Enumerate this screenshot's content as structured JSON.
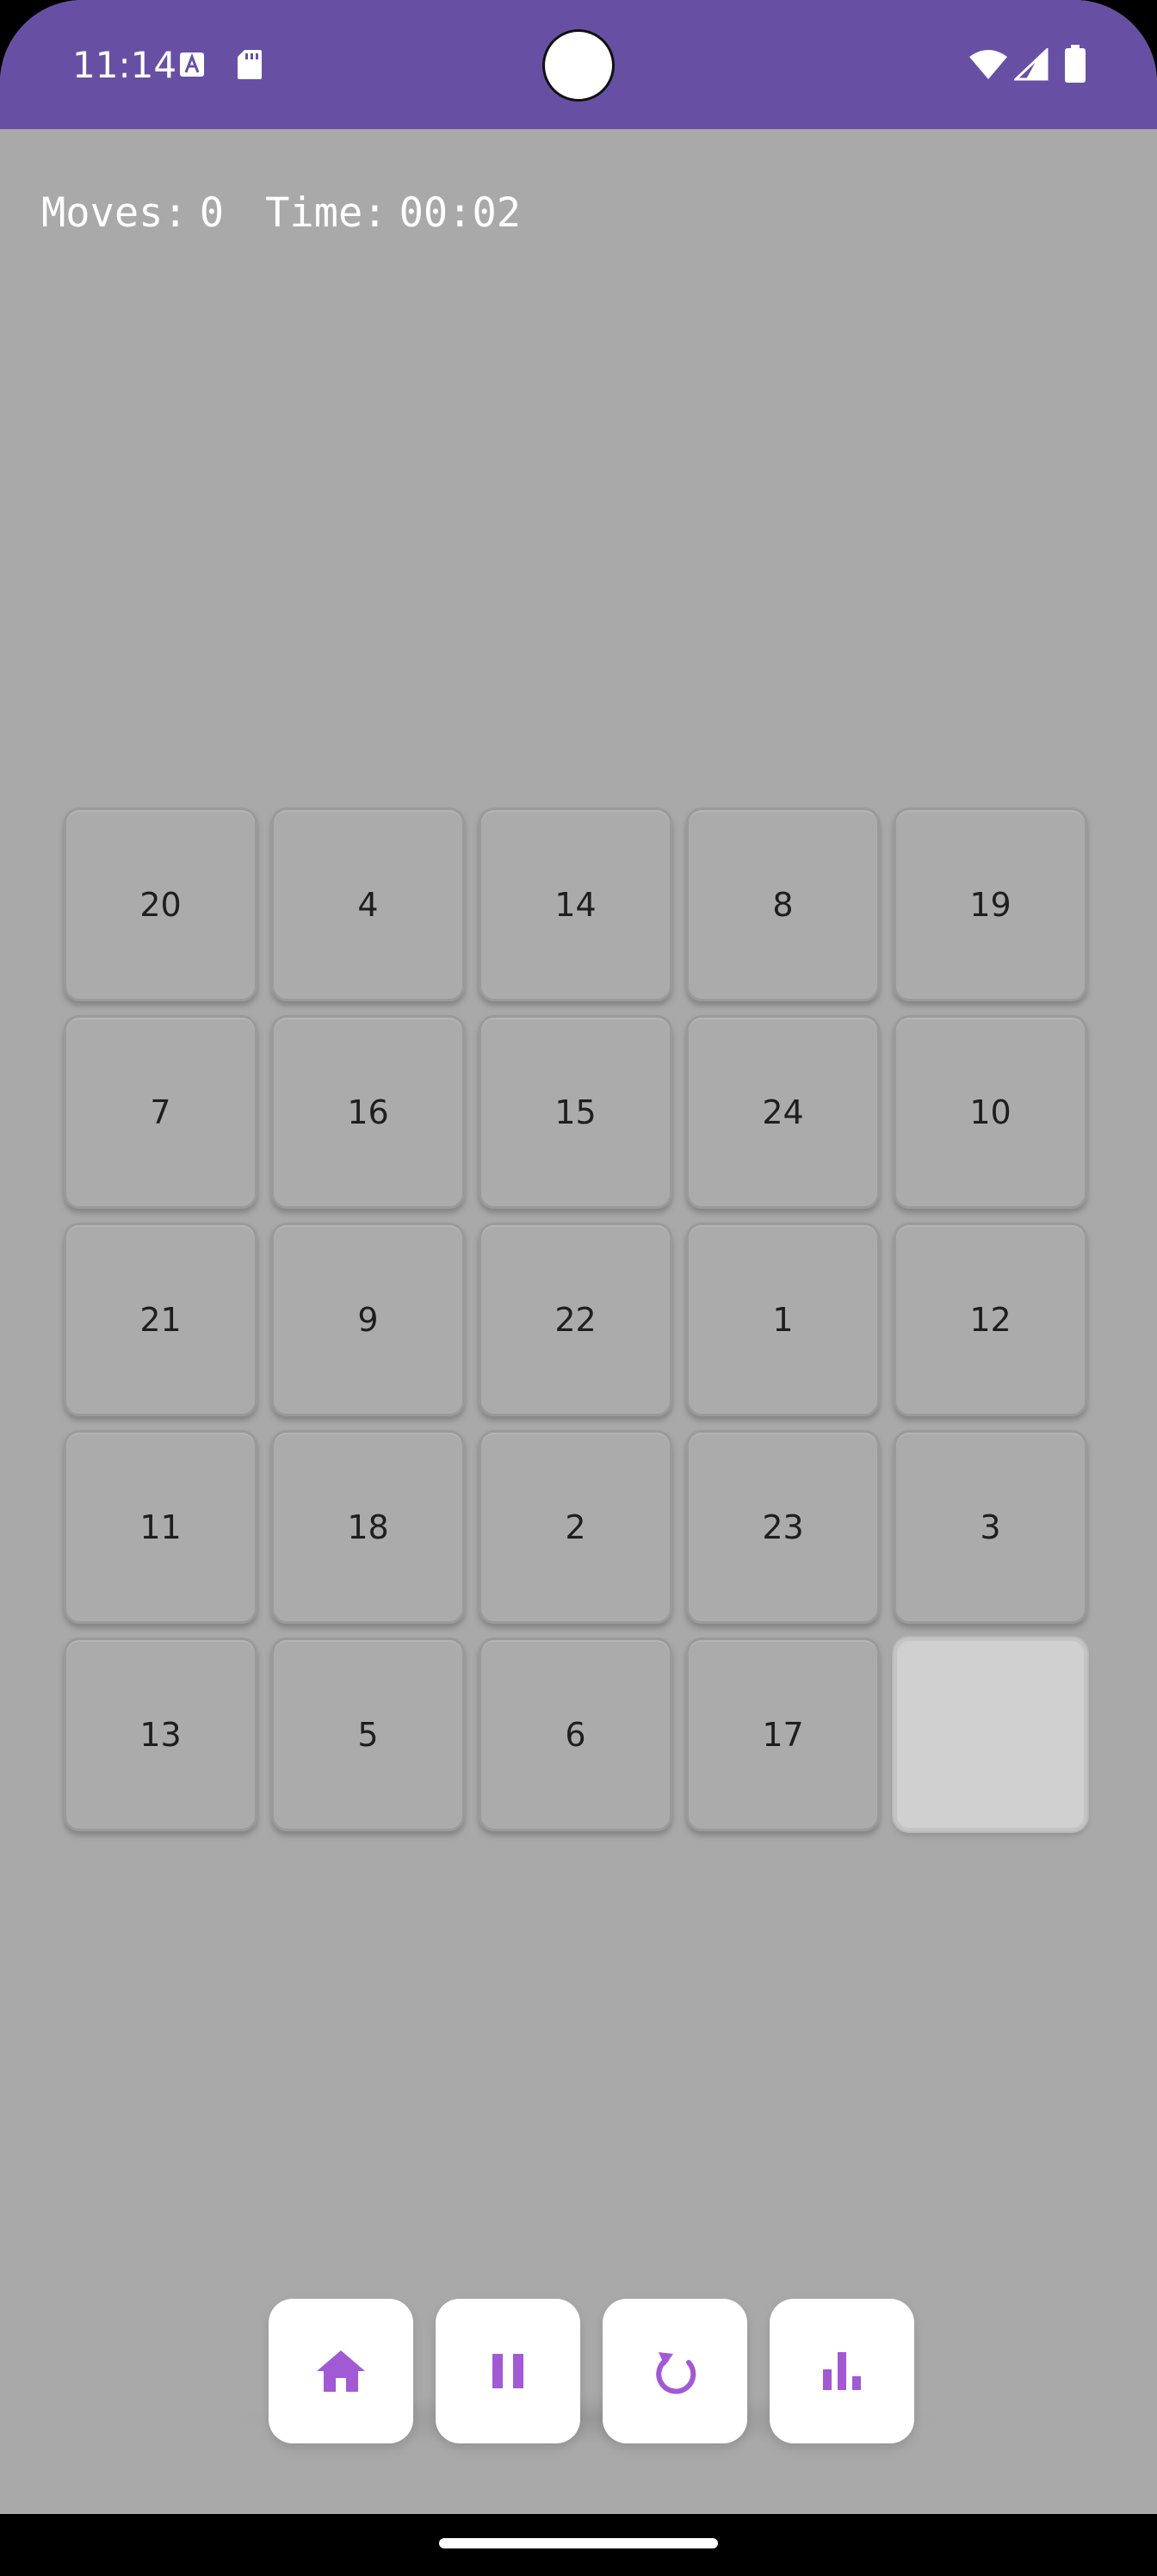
{
  "status_bar": {
    "time": "11:14",
    "icons": [
      "font-a-icon",
      "sd-card-icon",
      "wifi-icon",
      "signal-icon",
      "battery-icon"
    ],
    "color": "#6750a4"
  },
  "stats": {
    "moves_label": "Moves:",
    "moves_value": "0",
    "time_label": "Time:",
    "time_value": "00:02"
  },
  "board": {
    "size": 5,
    "tiles": [
      "20",
      "4",
      "14",
      "8",
      "19",
      "7",
      "16",
      "15",
      "24",
      "10",
      "21",
      "9",
      "22",
      "1",
      "12",
      "11",
      "18",
      "2",
      "23",
      "3",
      "13",
      "5",
      "6",
      "17",
      ""
    ]
  },
  "toolbar": {
    "buttons": [
      {
        "name": "home-button",
        "icon": "home-icon"
      },
      {
        "name": "pause-button",
        "icon": "pause-icon"
      },
      {
        "name": "restart-button",
        "icon": "refresh-icon"
      },
      {
        "name": "stats-button",
        "icon": "bar-chart-icon"
      }
    ],
    "accent": "#a259d4"
  },
  "colors": {
    "background": "#a9a9a9",
    "tile": "#ababab",
    "empty_tile": "#d0d0d0"
  }
}
